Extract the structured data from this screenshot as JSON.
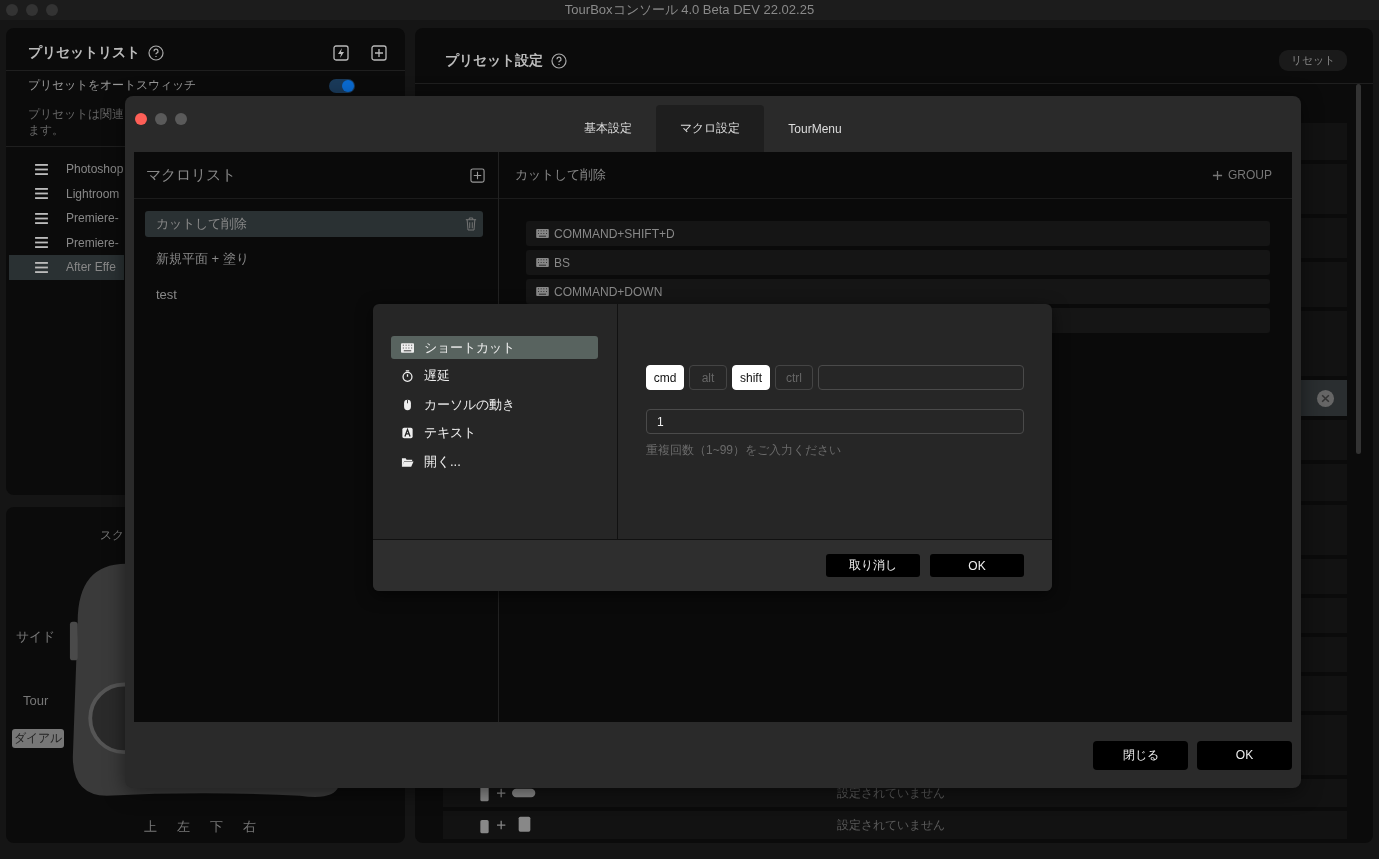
{
  "window": {
    "title": "TourBoxコンソール 4.0 Beta DEV 22.02.25"
  },
  "preset_list": {
    "title": "プリセットリスト",
    "auto_switch": {
      "label": "プリセットをオートスウィッチ",
      "on": true
    },
    "description": [
      "プリセットは関連",
      "ます。"
    ],
    "items": [
      {
        "name": "Photoshop",
        "selected": false
      },
      {
        "name": "Lightroom",
        "selected": false
      },
      {
        "name": "Premiere-",
        "selected": false
      },
      {
        "name": "Premiere-",
        "selected": false
      },
      {
        "name": "After Effe",
        "selected": true
      }
    ]
  },
  "device": {
    "caption": "スク",
    "labels": [
      {
        "text": "サイド",
        "selected": false
      },
      {
        "text": "Tour",
        "selected": false
      },
      {
        "text": "ダイアル",
        "selected": true
      }
    ],
    "bottom_labels": [
      "上",
      "左",
      "下",
      "右"
    ]
  },
  "preset_settings": {
    "title": "プリセット設定",
    "reset_button": "リセット",
    "rows": [
      {
        "selected": true
      },
      {
        "selected": false,
        "kind": "side_plus_wide",
        "status": "設定されていません"
      },
      {
        "selected": false,
        "kind": "side_plus_square",
        "status": "設定されていません"
      }
    ]
  },
  "macro_window": {
    "tabs": [
      {
        "label": "基本設定",
        "selected": false
      },
      {
        "label": "マクロ設定",
        "selected": true
      },
      {
        "label": "TourMenu",
        "selected": false
      }
    ],
    "macro_list": {
      "title": "マクロリスト",
      "items": [
        {
          "name": "カットして削除",
          "selected": true
        },
        {
          "name": "新規平面 + 塗り",
          "selected": false
        },
        {
          "name": "test",
          "selected": false
        }
      ]
    },
    "editor": {
      "title": "カットして削除",
      "group_button": "GROUP",
      "steps": [
        "COMMAND+SHIFT+D",
        "BS",
        "COMMAND+DOWN"
      ]
    },
    "buttons": [
      "閉じる",
      "OK"
    ]
  },
  "action_dialog": {
    "actions": [
      {
        "kind": "shortcut",
        "label": "ショートカット",
        "selected": true
      },
      {
        "kind": "delay",
        "label": "遅延",
        "selected": false
      },
      {
        "kind": "cursor",
        "label": "カーソルの動き",
        "selected": false
      },
      {
        "kind": "text",
        "label": "テキスト",
        "selected": false
      },
      {
        "kind": "open",
        "label": "開く...",
        "selected": false
      }
    ],
    "modifiers": [
      {
        "label": "cmd",
        "on": true
      },
      {
        "label": "alt",
        "on": false
      },
      {
        "label": "shift",
        "on": true
      },
      {
        "label": "ctrl",
        "on": false
      }
    ],
    "repeat_field": {
      "value": "1"
    },
    "hint": "重複回数（1~99）をご入力ください",
    "buttons": [
      "取り消し",
      "OK"
    ]
  }
}
